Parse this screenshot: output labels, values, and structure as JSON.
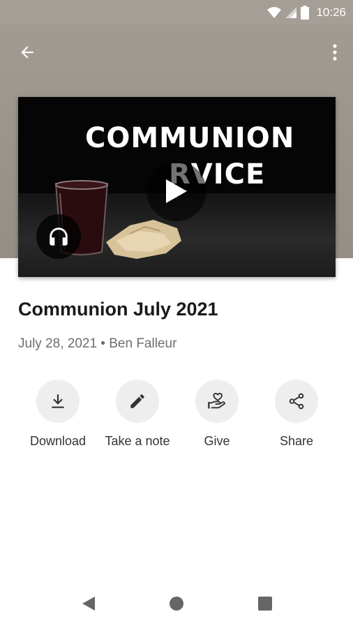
{
  "status_bar": {
    "time": "10:26"
  },
  "header": {
    "background_color": "#9d968e",
    "back_icon": "arrow-back-icon",
    "menu_icon": "more-vert-icon"
  },
  "artwork": {
    "line1": "COMMUNION",
    "line2": "RVICE",
    "play_icon": "play-icon",
    "audio_icon": "headphones-icon"
  },
  "sermon": {
    "title": "Communion July 2021",
    "meta": "July 28, 2021 • Ben Falleur"
  },
  "actions": [
    {
      "label": "Download",
      "icon": "download-icon"
    },
    {
      "label": "Take a note",
      "icon": "pencil-icon"
    },
    {
      "label": "Give",
      "icon": "give-hand-heart-icon"
    },
    {
      "label": "Share",
      "icon": "share-icon"
    }
  ],
  "nav": {
    "back_icon": "nav-back-triangle-icon",
    "home_icon": "nav-home-circle-icon",
    "recents_icon": "nav-recents-square-icon"
  }
}
